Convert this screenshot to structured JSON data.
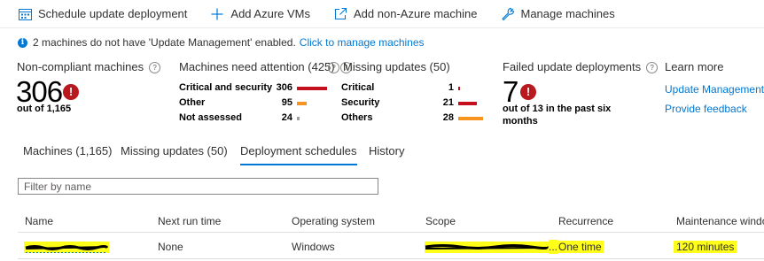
{
  "toolbar": {
    "schedule_label": "Schedule update deployment",
    "add_azure_label": "Add Azure VMs",
    "add_non_azure_label": "Add non-Azure machine",
    "manage_label": "Manage machines"
  },
  "info": {
    "message": "2 machines do not have 'Update Management' enabled.",
    "link": "Click to manage machines"
  },
  "summary": {
    "non_compliant": {
      "title": "Non-compliant machines",
      "value": "306",
      "sub": "out of 1,165"
    },
    "attention": {
      "title": "Machines need attention (425)",
      "rows": [
        {
          "label": "Critical and security",
          "value": "306",
          "fraction": 1.0,
          "color": "#c50f1f"
        },
        {
          "label": "Other",
          "value": "95",
          "fraction": 0.31,
          "color": "#f7941d"
        },
        {
          "label": "Not assessed",
          "value": "24",
          "fraction": 0.08,
          "color": "#a19f9d"
        }
      ]
    },
    "missing": {
      "title": "Missing updates (50)",
      "rows": [
        {
          "label": "Critical",
          "value": "1",
          "fraction": 0.04,
          "color": "#c50f1f"
        },
        {
          "label": "Security",
          "value": "21",
          "fraction": 0.75,
          "color": "#c50f1f"
        },
        {
          "label": "Others",
          "value": "28",
          "fraction": 1.0,
          "color": "#f7941d"
        }
      ]
    },
    "failed": {
      "title": "Failed update deployments",
      "value": "7",
      "sub_line1": "out of 13 in the past six",
      "sub_line2": "months"
    },
    "learn_more": {
      "title": "Learn more",
      "link1": "Update Management",
      "link2": "Provide feedback"
    }
  },
  "tabs": [
    {
      "label": "Machines (1,165)",
      "active": false
    },
    {
      "label": "Missing updates (50)",
      "active": false
    },
    {
      "label": "Deployment schedules",
      "active": true
    },
    {
      "label": "History",
      "active": false
    }
  ],
  "filter": {
    "placeholder": "Filter by name",
    "value": ""
  },
  "table": {
    "headers": [
      "Name",
      "Next run time",
      "Operating system",
      "Scope",
      "Recurrence",
      "Maintenance windo"
    ],
    "rows": [
      {
        "name": "",
        "next_run": "None",
        "os": "Windows",
        "scope": "...",
        "recurrence": "One time",
        "maintenance": "120 minutes"
      }
    ]
  },
  "colors": {
    "accent": "#0078d4",
    "error": "#b7191f",
    "highlight": "#ffff1a"
  }
}
